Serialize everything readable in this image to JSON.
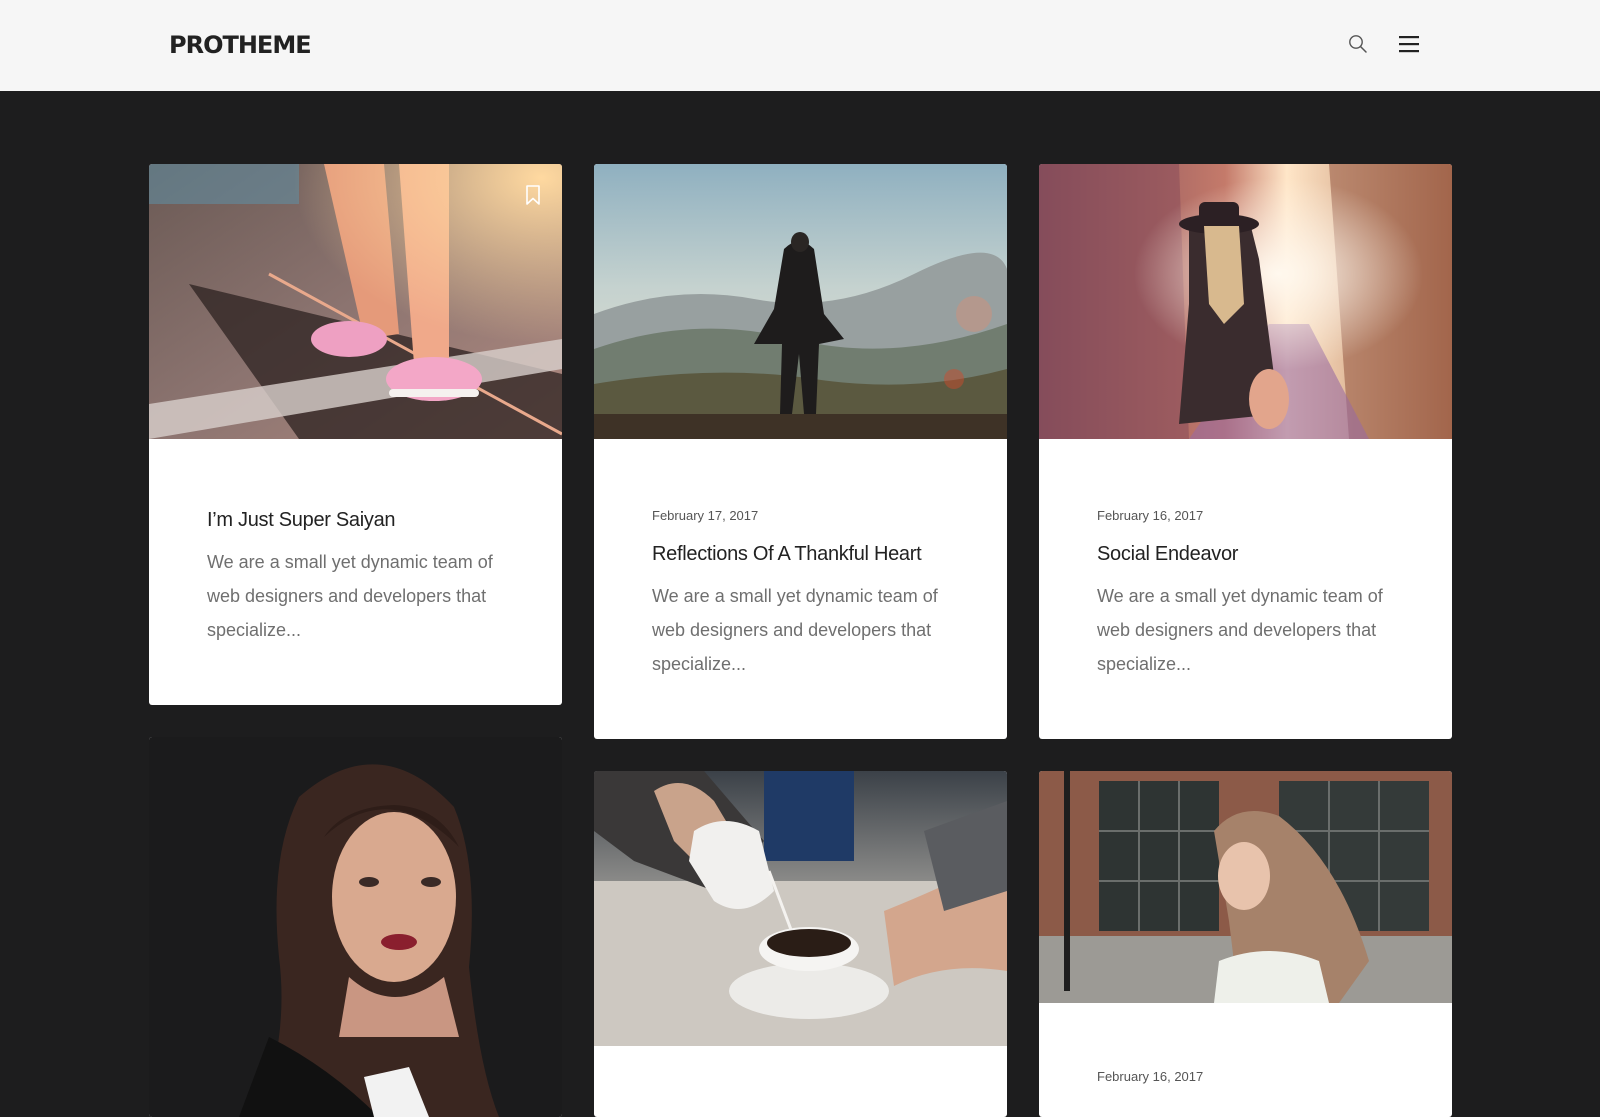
{
  "header": {
    "logo": "PROTHEME",
    "search_icon": "search-icon",
    "menu_icon": "hamburger-menu-icon"
  },
  "posts": [
    {
      "image": "legs-pink-sneakers-skateboard",
      "date": "",
      "title": "I’m Just Super Saiyan",
      "excerpt": "We are a small yet dynamic team of web designers and developers that specialize...",
      "bookmark_icon": "bookmark-icon"
    },
    {
      "image": "woman-mountain-view",
      "date": "February 17, 2017",
      "title": "Reflections Of A Thankful Heart",
      "excerpt": "We are a small yet dynamic team of web designers and developers that specialize..."
    },
    {
      "image": "woman-in-hat-alley-sunset",
      "date": "February 16, 2017",
      "title": "Social Endeavor",
      "excerpt": "We are a small yet dynamic team of web designers and developers that specialize..."
    },
    {
      "image": "woman-portrait-dark"
    },
    {
      "image": "pouring-milk-into-coffee"
    },
    {
      "image": "woman-hair-blowing-street",
      "date": "February 16, 2017"
    }
  ],
  "colors": {
    "header_bg": "#f6f6f6",
    "page_bg": "#1d1d1e",
    "card_bg": "#ffffff",
    "title": "#222222",
    "excerpt": "#6f6f6f"
  }
}
